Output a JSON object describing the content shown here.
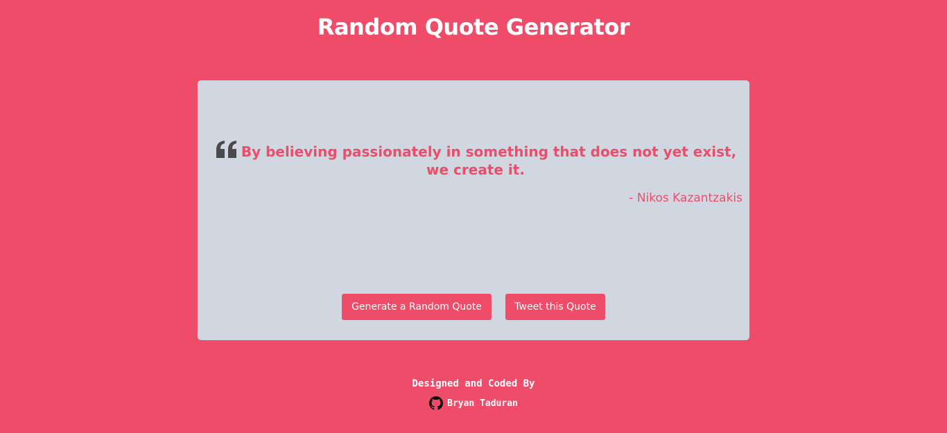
{
  "header": {
    "title": "Random Quote Generator"
  },
  "quote": {
    "icon": "quote-left-icon",
    "text": "By believing passionately in something that does not yet exist, we create it.",
    "author": "- Nikos Kazantzakis"
  },
  "actions": {
    "generate_label": "Generate a Random Quote",
    "tweet_label": "Tweet this Quote"
  },
  "footer": {
    "credit_label": "Designed and Coded By",
    "author_icon": "github-icon",
    "author_name": "Bryan Taduran"
  },
  "colors": {
    "background": "#ee4c68",
    "card": "#d0d7e1",
    "accent": "#ee4c68",
    "quote_mark": "#4a4a4a",
    "text_light": "#ffffff"
  }
}
